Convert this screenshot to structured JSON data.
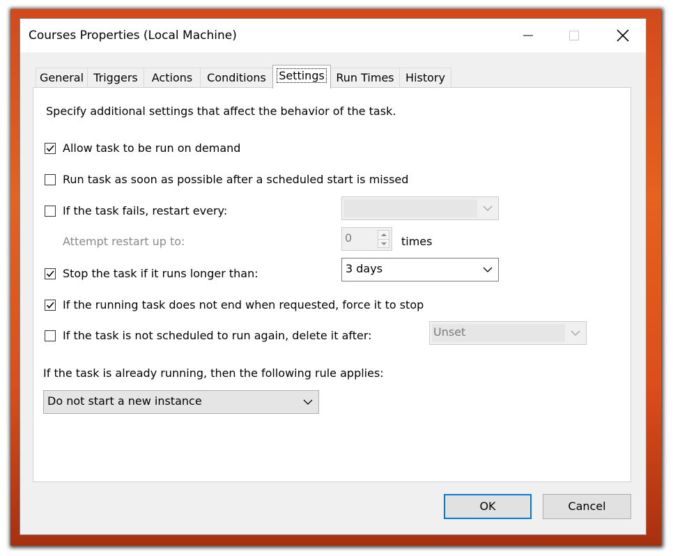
{
  "window": {
    "title": "Courses Properties (Local Machine)"
  },
  "tabs": [
    {
      "label": "General"
    },
    {
      "label": "Triggers"
    },
    {
      "label": "Actions"
    },
    {
      "label": "Conditions"
    },
    {
      "label": "Settings",
      "active": true
    },
    {
      "label": "Run Times"
    },
    {
      "label": "History"
    }
  ],
  "settings": {
    "description": "Specify additional settings that affect the behavior of the task.",
    "allow_on_demand": {
      "label": "Allow task to be run on demand",
      "checked": true
    },
    "run_missed": {
      "label": "Run task as soon as possible after a scheduled start is missed",
      "checked": false
    },
    "restart_on_fail": {
      "label": "If the task fails, restart every:",
      "checked": false,
      "value": ""
    },
    "attempt_restart": {
      "label": "Attempt restart up to:",
      "value": "0",
      "unit": "times"
    },
    "stop_if_longer": {
      "label": "Stop the task if it runs longer than:",
      "checked": true,
      "value": "3 days"
    },
    "force_stop": {
      "label": "If the running task does not end when requested, force it to stop",
      "checked": true
    },
    "delete_after": {
      "label": "If the task is not scheduled to run again, delete it after:",
      "checked": false,
      "value": "Unset"
    },
    "running_rule_label": "If the task is already running, then the following rule applies:",
    "running_rule_value": "Do not start a new instance"
  },
  "buttons": {
    "ok": "OK",
    "cancel": "Cancel"
  },
  "colors": {
    "accent": "#0078d7",
    "desktop": "#e5621f"
  }
}
